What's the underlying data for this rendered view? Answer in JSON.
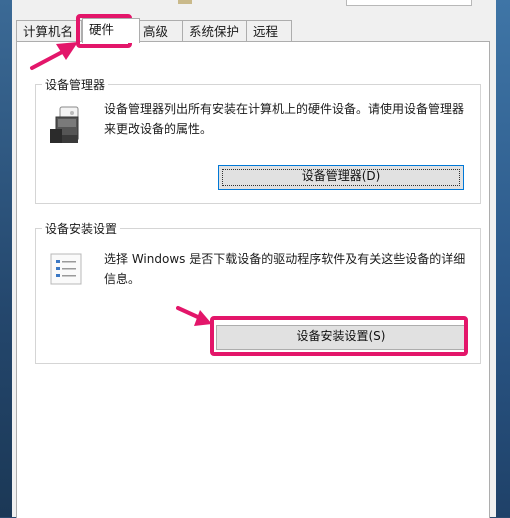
{
  "tabs": [
    {
      "label": "计算机名"
    },
    {
      "label": "硬件"
    },
    {
      "label": "高级"
    },
    {
      "label": "系统保护"
    },
    {
      "label": "远程"
    }
  ],
  "device_manager": {
    "group_title": "设备管理器",
    "description": "设备管理器列出所有安装在计算机上的硬件设备。请使用设备管理器来更改设备的属性。",
    "button_label": "设备管理器(D)",
    "icon": "device-manager-icon"
  },
  "device_install": {
    "group_title": "设备安装设置",
    "description": "选择 Windows 是否下载设备的驱动程序软件及有关这些设备的详细信息。",
    "button_label": "设备安装设置(S)",
    "icon": "settings-checklist-icon"
  },
  "colors": {
    "highlight": "#e3166a",
    "tab_active_bg": "#ffffff",
    "button_bg": "#e1e1e1"
  }
}
